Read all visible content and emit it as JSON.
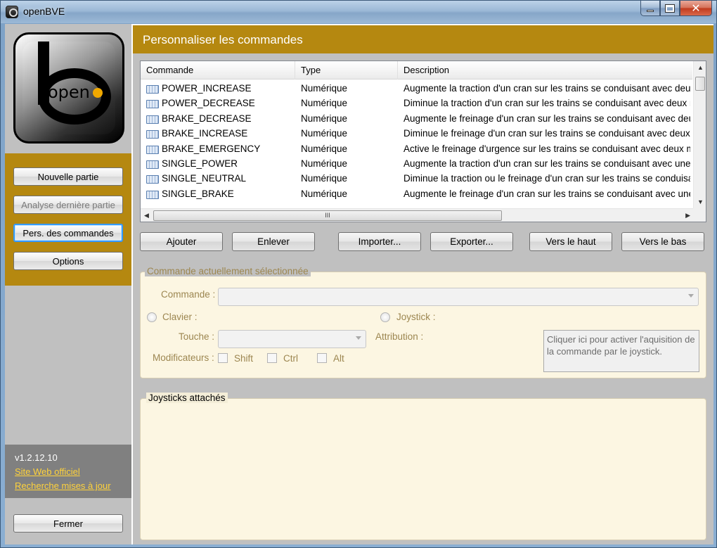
{
  "window": {
    "title": "openBVE"
  },
  "sidebar": {
    "logo_text": "open",
    "buttons": {
      "new_game": "Nouvelle partie",
      "review_last": "Analyse dernière partie",
      "customize": "Pers. des commandes",
      "options": "Options"
    },
    "version": "v1.2.12.10",
    "links": {
      "website": "Site Web officiel",
      "updates": "Recherche mises à jour"
    },
    "close": "Fermer"
  },
  "header": {
    "title": "Personnaliser les commandes"
  },
  "list": {
    "columns": [
      "Commande",
      "Type",
      "Description"
    ],
    "rows": [
      {
        "command": "POWER_INCREASE",
        "type": "Numérique",
        "description": "Augmente la traction d'un cran sur les trains se conduisant avec deux"
      },
      {
        "command": "POWER_DECREASE",
        "type": "Numérique",
        "description": "Diminue la traction d'un cran sur les trains se conduisant avec deux m"
      },
      {
        "command": "BRAKE_DECREASE",
        "type": "Numérique",
        "description": "Augmente le freinage d'un cran sur les trains se conduisant avec deu"
      },
      {
        "command": "BRAKE_INCREASE",
        "type": "Numérique",
        "description": "Diminue le freinage d'un cran sur les trains se conduisant avec deux"
      },
      {
        "command": "BRAKE_EMERGENCY",
        "type": "Numérique",
        "description": "Active le freinage d'urgence sur les trains se conduisant avec deux m"
      },
      {
        "command": "SINGLE_POWER",
        "type": "Numérique",
        "description": "Augmente la traction d'un cran sur les trains se conduisant avec une"
      },
      {
        "command": "SINGLE_NEUTRAL",
        "type": "Numérique",
        "description": "Diminue la traction ou le freinage d'un cran sur les trains se conduisa"
      },
      {
        "command": "SINGLE_BRAKE",
        "type": "Numérique",
        "description": "Augmente le freinage d'un cran sur les trains se conduisant avec une"
      }
    ],
    "hscroll_grip": "III"
  },
  "actions": {
    "add": "Ajouter",
    "remove": "Enlever",
    "import": "Importer...",
    "export": "Exporter...",
    "up": "Vers le haut",
    "down": "Vers le bas"
  },
  "selected": {
    "legend": "Commande actuellement sélectionnée",
    "command_label": "Commande :",
    "keyboard_label": "Clavier :",
    "joystick_label": "Joystick :",
    "key_label": "Touche :",
    "assignment_label": "Attribution :",
    "modifiers_label": "Modificateurs :",
    "shift": "Shift",
    "ctrl": "Ctrl",
    "alt": "Alt",
    "joystick_hint": "Cliquer ici pour activer l'aquisition de la commande par le joystick."
  },
  "joysticks": {
    "legend": "Joysticks attachés"
  }
}
